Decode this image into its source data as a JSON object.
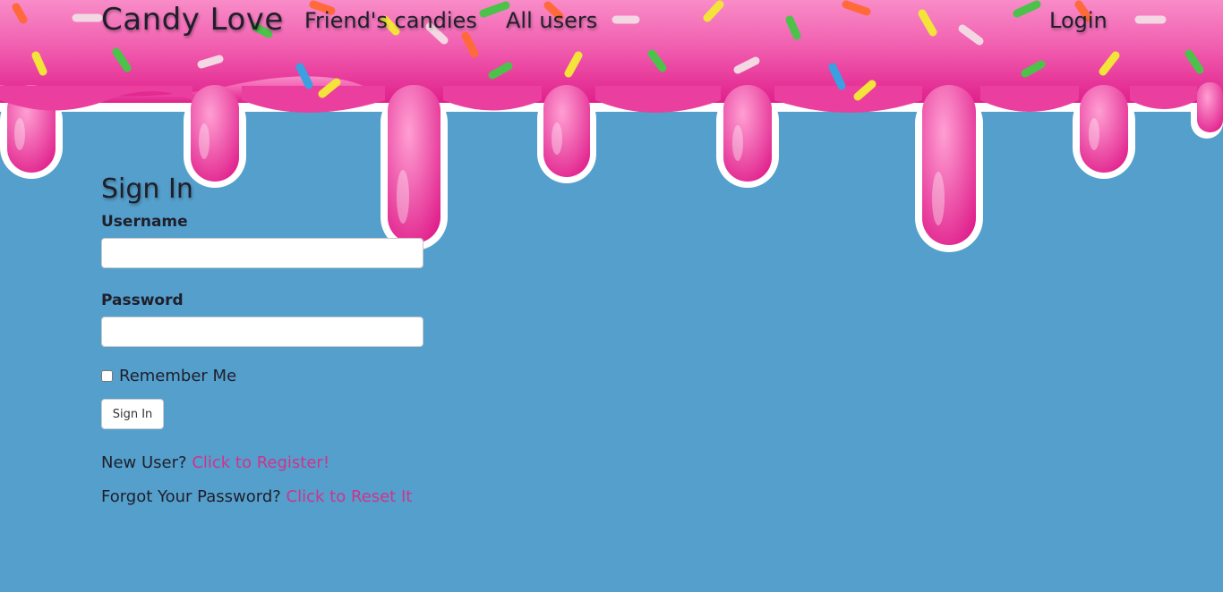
{
  "navbar": {
    "brand": "Candy Love",
    "links": {
      "friends_candies": "Friend's candies",
      "all_users": "All users",
      "login": "Login"
    }
  },
  "signin": {
    "title": "Sign In",
    "username_label": "Username",
    "username_value": "",
    "password_label": "Password",
    "password_value": "",
    "remember_me_label": "Remember Me",
    "remember_me_checked": false,
    "submit_label": "Sign In"
  },
  "help": {
    "register_prompt": "New User?",
    "register_link": "Click to Register!",
    "reset_prompt": "Forgot Your Password?",
    "reset_link": "Click to Reset It"
  },
  "colors": {
    "background": "#549fcc",
    "icing_pink": "#f15fb0",
    "icing_dark": "#e0208c",
    "icing_outline": "#ffffff",
    "link_pink": "#d0338a",
    "text": "#1f1f2a"
  }
}
